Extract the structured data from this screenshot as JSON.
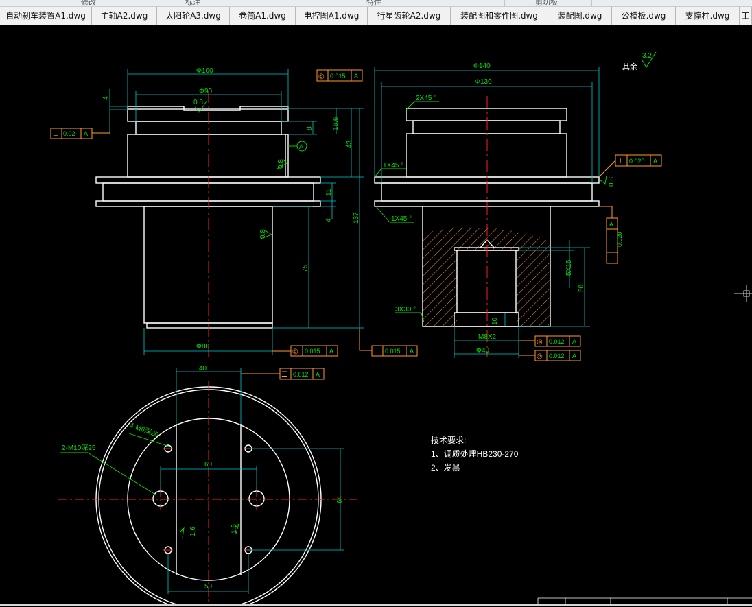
{
  "ribbon": {
    "groups": [
      "修改",
      "标注",
      "特性",
      "剪切板"
    ]
  },
  "tabs": [
    {
      "label": "自动刹车装置A1.dwg"
    },
    {
      "label": "主轴A2.dwg"
    },
    {
      "label": "太阳轮A3.dwg"
    },
    {
      "label": "卷筒A1.dwg"
    },
    {
      "label": "电控图A1.dwg"
    },
    {
      "label": "行星齿轮A2.dwg"
    },
    {
      "label": "装配图和零件图.dwg"
    },
    {
      "label": "装配图.dwg"
    },
    {
      "label": "公模板.dwg"
    },
    {
      "label": "支撑柱.dwg"
    },
    {
      "label": "工"
    }
  ],
  "colors": {
    "outline": "#ffffff",
    "centerline": "#ff2020",
    "dimension": "#00c8c8",
    "dimtext": "#00e000",
    "leader": "#00e000",
    "frame": "#ff9a30",
    "hatch": "#ff9a30",
    "techtext": "#ffffff"
  },
  "drawing": {
    "front": {
      "dia_top": "Φ100",
      "dia_inner": "Φ90",
      "dia_bottom": "Φ80",
      "dim_4": "4",
      "dim_8": "8",
      "dim_16": "16.6",
      "dim_43": "43",
      "dim_11": "11",
      "dim_4b": "4",
      "dim_75": "75",
      "dim_137": "137",
      "rough_top": "0.8",
      "rough_mid": "0.8",
      "rough_low": "0.8",
      "datum": "A",
      "tol_top": {
        "sym": "◎",
        "val": "0.015",
        "ref": "A"
      },
      "tol_left": {
        "sym": "⊥",
        "val": "0.02",
        "ref": "A"
      },
      "tol_bottom": {
        "sym": "◎",
        "val": "0.015",
        "ref": "A"
      },
      "tol_bottom2": {
        "sym": "⊥",
        "val": "0.015",
        "ref": "A"
      }
    },
    "section": {
      "dia_top": "Φ140",
      "dia_2": "Φ130",
      "chamfer_top": "2X45 °",
      "chamfer_left": "1X45 °",
      "chamfer_left2": "1X45 °",
      "chamfer_bottom": "3X30 °",
      "thread": "M8X2",
      "dia_bore": "Φ40",
      "dim_5x15": "5X15",
      "dim_50": "50",
      "dim_10": "10",
      "rough_right": "0.8",
      "tol_right": {
        "sym": "⊥",
        "val": "0.020",
        "ref": "A"
      },
      "tol_vert": {
        "val": "0.020",
        "ref": "A"
      },
      "tol_b1": {
        "sym": "◎",
        "val": "0.012",
        "ref": "A"
      },
      "tol_b2": {
        "sym": "◎",
        "val": "0.012",
        "ref": "A"
      }
    },
    "top": {
      "dim_40": "40",
      "tol": {
        "sym": "☰",
        "val": "0.012",
        "ref": "A"
      },
      "label_m10": "2-M10深25",
      "label_m6": "4-M6深20",
      "dim_60": "60",
      "dim_64": "64",
      "dim_50": "50",
      "rough_l": "1.6",
      "rough_r": "1.6"
    },
    "tech": {
      "title": "技术要求:",
      "line1": "1、调质处理HB230-270",
      "line2": "2、发黑"
    },
    "rest": {
      "text": "其余",
      "value": "3.2"
    }
  }
}
